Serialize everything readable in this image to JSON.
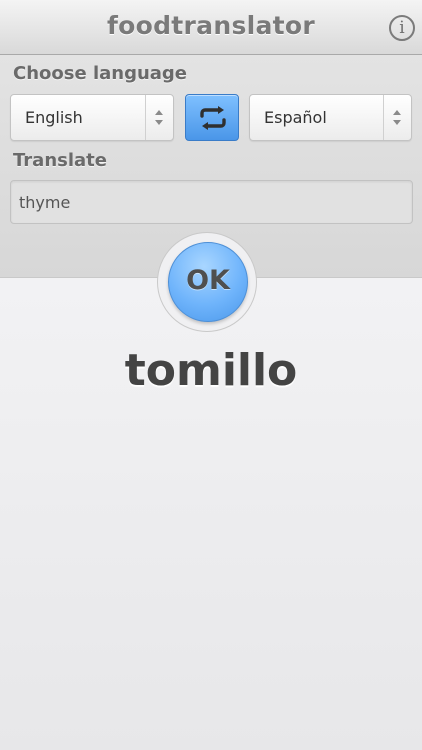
{
  "header": {
    "title": "foodtranslator",
    "info_icon": "info-icon",
    "info_glyph": "i"
  },
  "language": {
    "label": "Choose language",
    "source": "English",
    "target": "Español",
    "swap_icon": "swap-arrows-icon"
  },
  "translate": {
    "label": "Translate",
    "input_value": "thyme"
  },
  "action": {
    "ok_label": "OK"
  },
  "result": {
    "word": "tomillo"
  },
  "colors": {
    "accent_blue": "#6fb4fb",
    "title_gray": "#7a7a7a"
  }
}
